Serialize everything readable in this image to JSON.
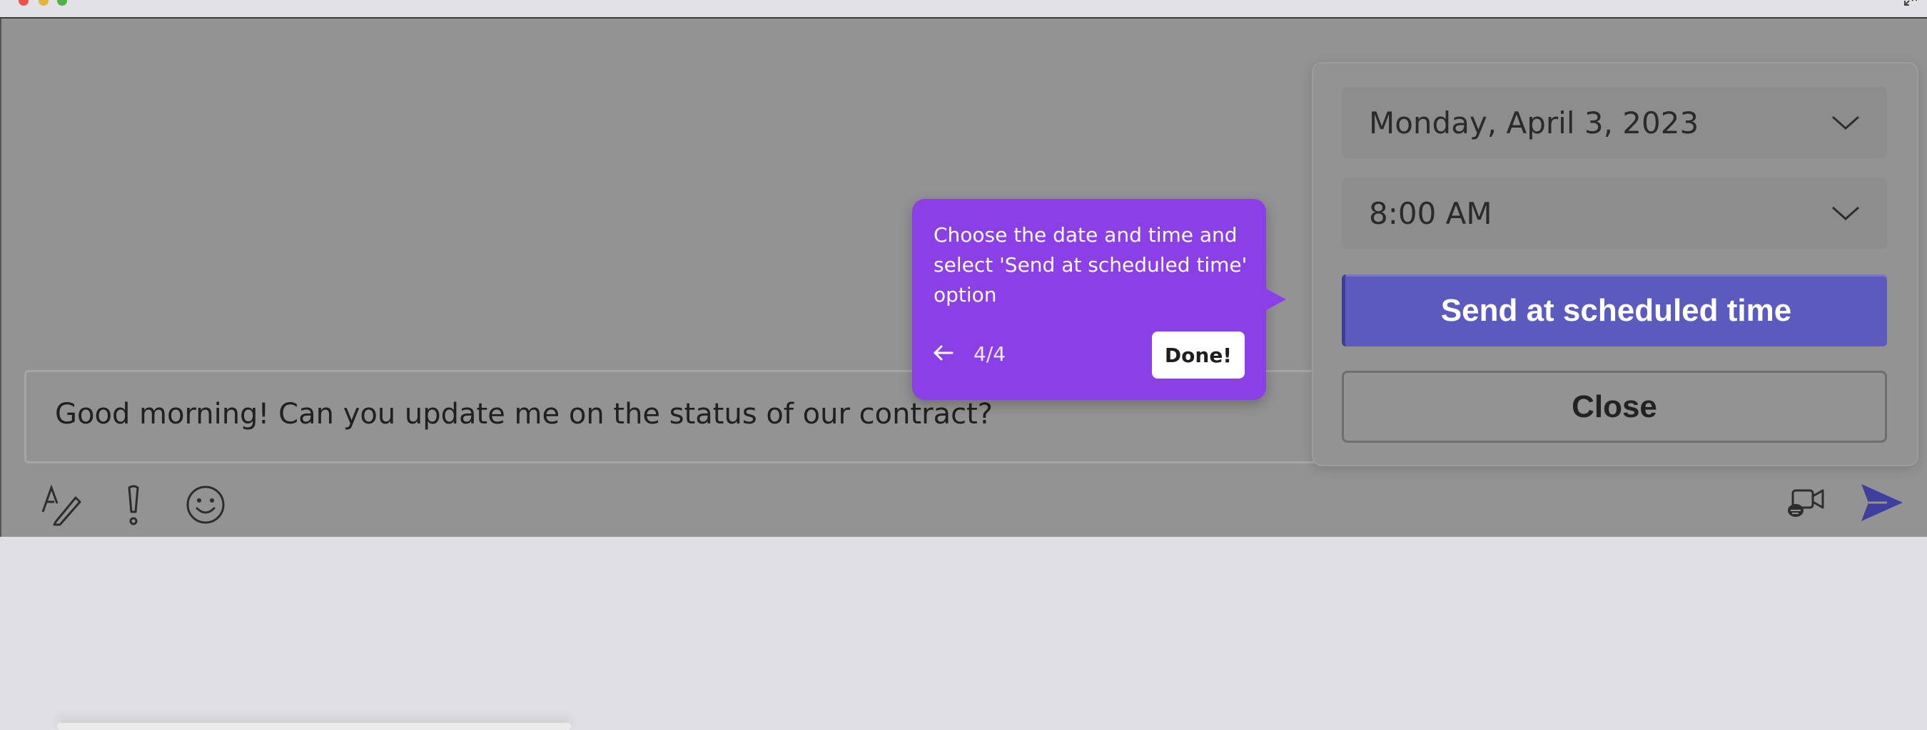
{
  "compose": {
    "message": "Good morning! Can you update me on the status of our contract?"
  },
  "toolbar": {
    "icons": [
      "format-icon",
      "priority-icon",
      "emoji-icon",
      "meet-now-icon",
      "send-icon"
    ]
  },
  "schedule": {
    "date_value": "Monday, April 3, 2023",
    "time_value": "8:00 AM",
    "send_label": "Send at scheduled time",
    "close_label": "Close"
  },
  "tour": {
    "text": "Choose the date and time and select 'Send at scheduled time' option",
    "step": "4/4",
    "done_label": "Done!"
  },
  "colors": {
    "overlay": "#939393",
    "accent_button": "#5b5bbf",
    "tooltip": "#8b3fe6",
    "send_icon": "#3f3f9e"
  }
}
